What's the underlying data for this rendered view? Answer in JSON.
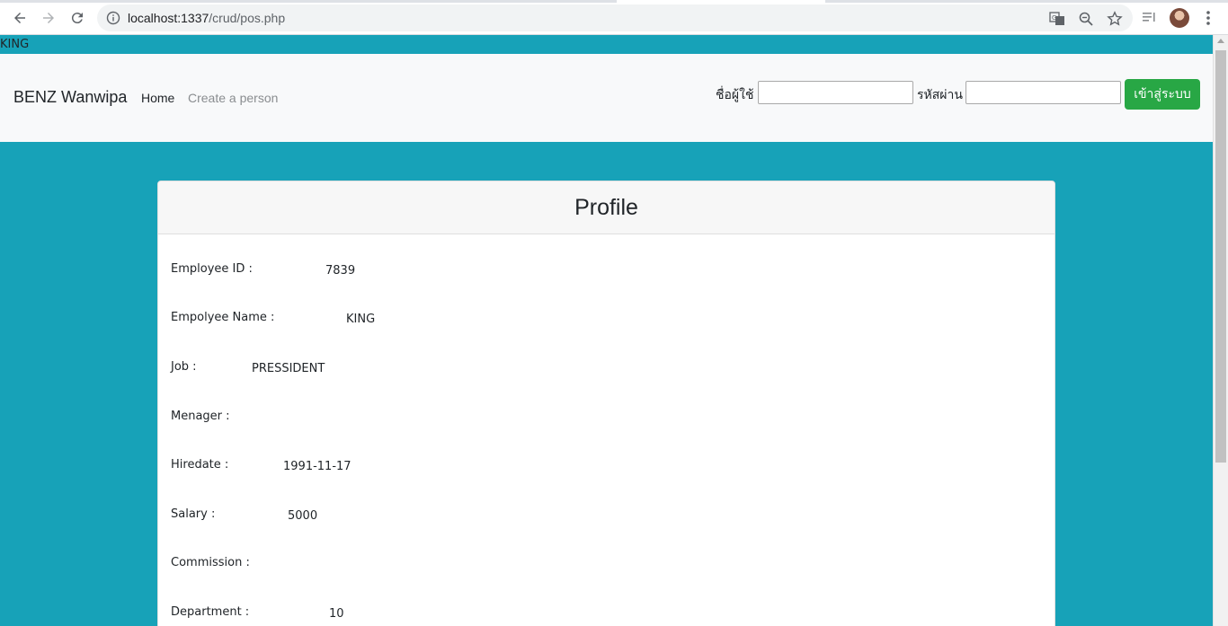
{
  "browser": {
    "url_host": "localhost:1337",
    "url_path": "/crud/pos.php"
  },
  "top_strip": "KING",
  "navbar": {
    "brand": "BENZ Wanwipa",
    "home": "Home",
    "create": "Create a person",
    "username_label": "ชื่อผู้ใช้",
    "password_label": "รหัสผ่าน",
    "login_button": "เข้าสู่ระบบ"
  },
  "profile": {
    "title": "Profile",
    "fields": [
      {
        "label": "Employee ID :",
        "value": "7839"
      },
      {
        "label": "Empolyee Name :",
        "value": "KING"
      },
      {
        "label": "Job :",
        "value": "PRESSIDENT"
      },
      {
        "label": "Menager :",
        "value": ""
      },
      {
        "label": "Hiredate :",
        "value": "1991-11-17"
      },
      {
        "label": "Salary :",
        "value": "5000"
      },
      {
        "label": "Commission :",
        "value": ""
      },
      {
        "label": "Department :",
        "value": "10"
      }
    ]
  }
}
